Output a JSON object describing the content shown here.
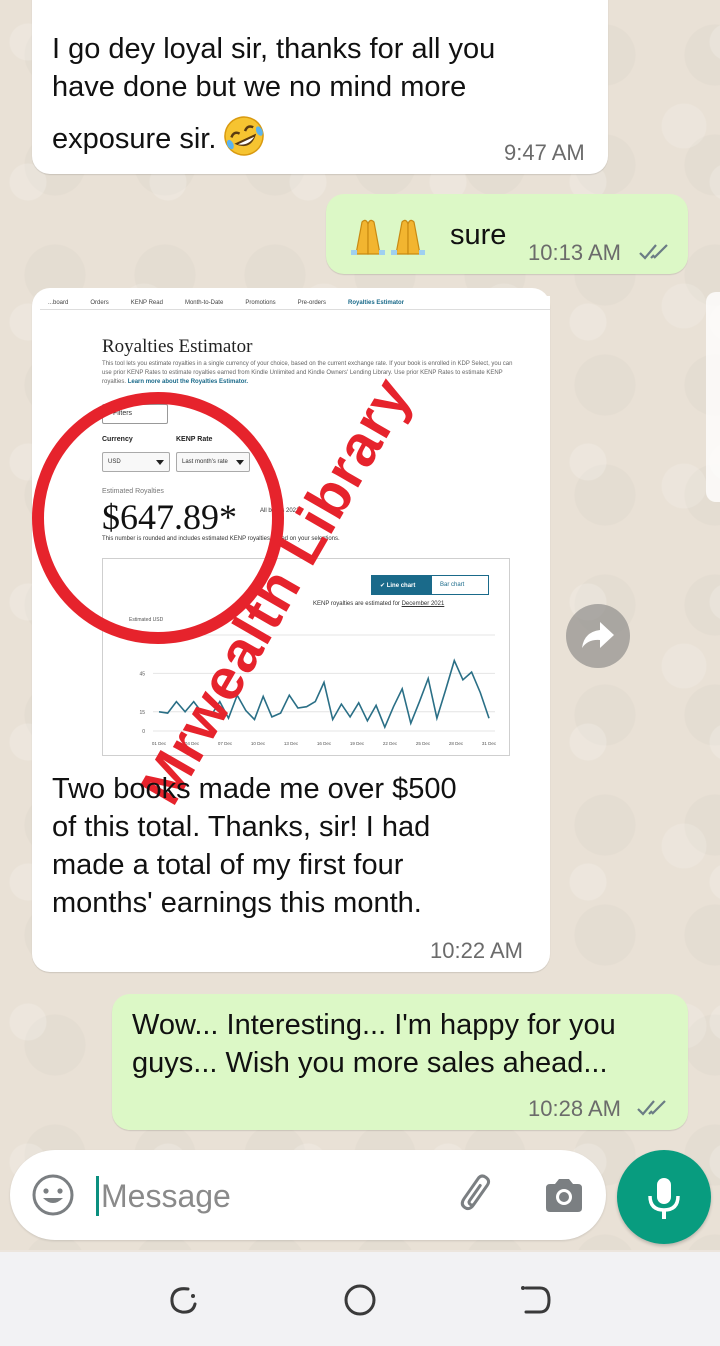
{
  "messages": [
    {
      "id": "m1",
      "direction": "incoming",
      "text_lines": [
        "I go dey loyal sir, thanks for all you",
        "have done but we no mind more",
        "exposure sir."
      ],
      "emoji": "rolling-on-floor-laughing",
      "time": "9:47 AM"
    },
    {
      "id": "m2",
      "direction": "outgoing",
      "emoji": "folded-hands x2",
      "text": "sure",
      "time": "10:13 AM",
      "status": "read"
    },
    {
      "id": "m3",
      "direction": "incoming",
      "image": {
        "nav_items": [
          "...board",
          "Orders",
          "KENP Read",
          "Month-to-Date",
          "Promotions",
          "Pre-orders",
          "Royalties Estimator"
        ],
        "title": "Royalties Estimator",
        "description": "This tool lets you estimate royalties in a single currency of your choice, based on the current exchange rate. If your book is enrolled in KDP Select, you can use prior KENP Rates to estimate royalties earned from Kindle Unlimited and Kindle Owners' Lending Library. Use prior KENP Rates to estimate KENP royalties.",
        "learn_more": "Learn more about the Royalties Estimator.",
        "filters_label": "Filters",
        "currency_label": "Currency",
        "currency_value": "USD",
        "kenp_rate_label": "KENP Rate",
        "kenp_rate_value": "Last month's rate",
        "estimated_label": "Estimated Royalties",
        "amount": "$647.89*",
        "side_note": "All books 2021",
        "rounded_note": "This number is rounded and includes estimated KENP royalties based on your selections.",
        "line_chart_label": "Line chart",
        "bar_chart_label": "Bar chart",
        "kenp_note_prefix": "KENP royalties are estimated for ",
        "kenp_note_link": "December 2021",
        "watermark": "Mrwealth Library",
        "accent_color": "#1a6a8a",
        "watermark_color": "#e6232c"
      },
      "caption_lines": [
        "Two books made me over $500",
        "of this total. Thanks, sir! I had",
        "made a total of my first four",
        "months' earnings this month."
      ],
      "time": "10:22 AM"
    },
    {
      "id": "m4",
      "direction": "outgoing",
      "text_lines": [
        "Wow... Interesting... I'm happy for you",
        "guys... Wish you more sales ahead..."
      ],
      "time": "10:28 AM",
      "status": "read"
    }
  ],
  "chart_data": {
    "type": "line",
    "ylabel": "Estimated USD",
    "y_ticks": [
      "75",
      "45",
      "15",
      "0"
    ],
    "ylim": [
      0,
      75
    ],
    "x_ticks": [
      "01 Dec",
      "04 Dec",
      "07 Dec",
      "10 Dec",
      "13 Dec",
      "16 Dec",
      "19 Dec",
      "22 Dec",
      "25 Dec",
      "28 Dec",
      "31 Dec"
    ],
    "series": [
      {
        "values": [
          15,
          14,
          23,
          15,
          23,
          14,
          12,
          23,
          10,
          28,
          16,
          9,
          27,
          11,
          14,
          28,
          18,
          19,
          23,
          38,
          9,
          21,
          11,
          22,
          8,
          20,
          3,
          19,
          33,
          6,
          23,
          41,
          10,
          32,
          55,
          40,
          46,
          30,
          10
        ]
      }
    ],
    "line_color": "#2a6f86"
  },
  "composer": {
    "placeholder": "Message"
  },
  "colors": {
    "incoming_bubble": "#ffffff",
    "outgoing_bubble": "#dcf8c6",
    "mic_button": "#089c7f",
    "read_ticks": "#6b7c85"
  }
}
